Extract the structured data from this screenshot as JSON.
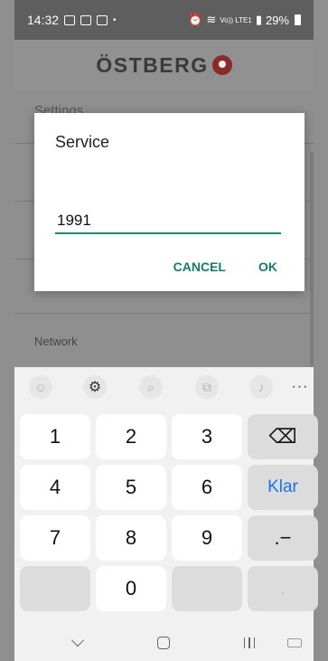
{
  "status_bar": {
    "time": "14:32",
    "battery": "29%",
    "signal_text": "Vo)) LTE1"
  },
  "header": {
    "logo_text": "ÖSTBERG"
  },
  "content": {
    "settings_label": "Settings",
    "network_label": "Network"
  },
  "dialog": {
    "title": "Service",
    "input_value": "1991",
    "cancel_label": "CANCEL",
    "ok_label": "OK"
  },
  "keyboard": {
    "rows": [
      [
        "1",
        "2",
        "3",
        "⌫"
      ],
      [
        "4",
        "5",
        "6",
        "Klar"
      ],
      [
        "7",
        "8",
        "9",
        ".−"
      ],
      [
        "",
        "0",
        "",
        ","
      ]
    ],
    "toolbar_icons": [
      "emoji-icon",
      "gear-icon",
      "search-icon",
      "clipboard-icon",
      "mic-icon",
      "more-icon"
    ]
  },
  "nav_bar": {
    "icons": [
      "back-chevron-icon",
      "home-icon",
      "recents-icon",
      "keyboard-switch-icon"
    ]
  },
  "colors": {
    "accent": "#167a6d",
    "keyboard_action": "#1a73e8"
  }
}
